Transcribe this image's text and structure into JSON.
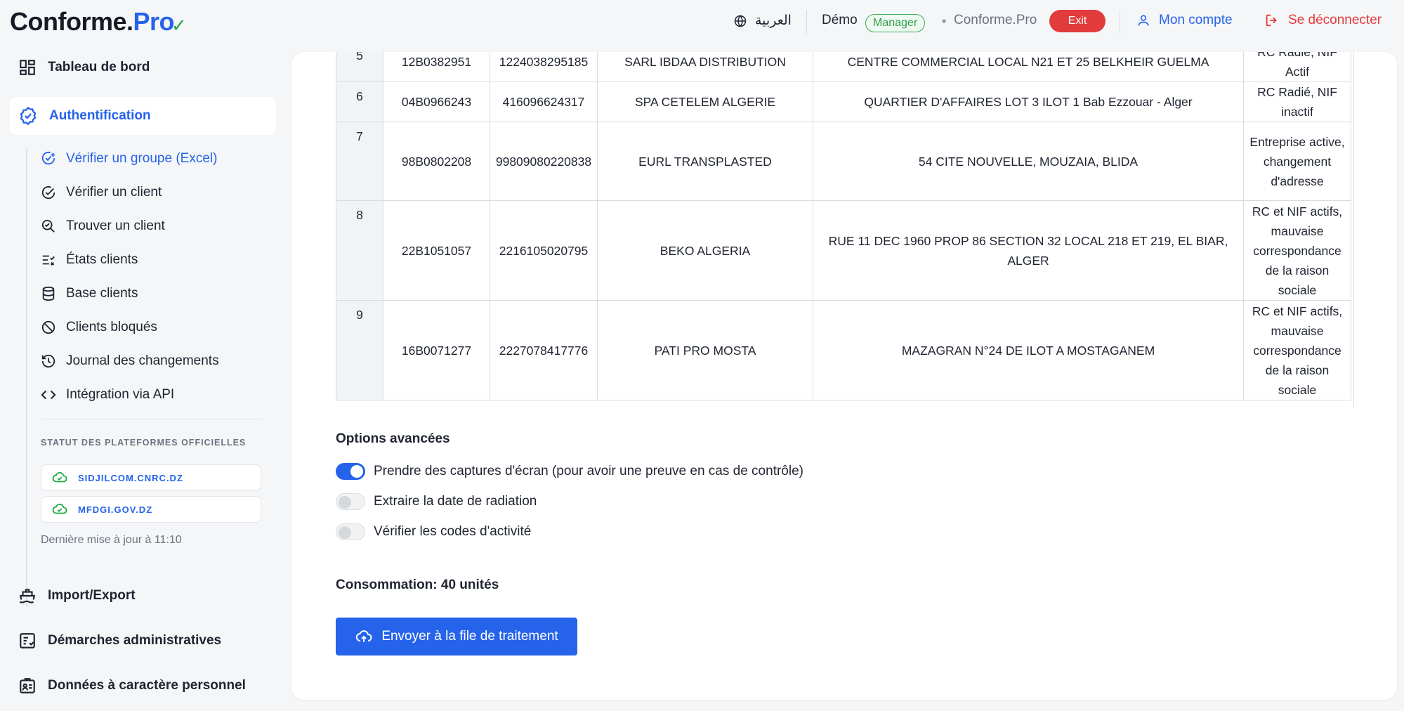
{
  "header": {
    "logo_main": "Conforme.",
    "logo_accent": "Pro",
    "language": "العربية",
    "demo_label": "Démo",
    "role_badge": "Manager",
    "brand_text": "Conforme.Pro",
    "exit_label": "Exit",
    "account_label": "Mon compte",
    "logout_label": "Se déconnecter"
  },
  "sidebar": {
    "dashboard": "Tableau de bord",
    "auth": "Authentification",
    "sub_items": [
      "Vérifier un groupe (Excel)",
      "Vérifier un client",
      "Trouver un client",
      "États clients",
      "Base clients",
      "Clients bloqués",
      "Journal des changements",
      "Intégration via API"
    ],
    "status_title": "STATUT DES PLATEFORMES OFFICIELLES",
    "platforms": [
      "SIDJILCOM.CNRC.DZ",
      "MFDGI.GOV.DZ"
    ],
    "last_update": "Dernière mise à jour à 11:10",
    "import_export": "Import/Export",
    "admin": "Démarches administratives",
    "personal_data": "Données à caractère personnel"
  },
  "table": {
    "rows": [
      {
        "num": "5",
        "rc": "12B0382951",
        "nif": "1224038295185",
        "name": "SARL IBDAA DISTRIBUTION",
        "address": "CENTRE COMMERCIAL LOCAL N21 ET 25 BELKHEIR GUELMA",
        "status": "RC Radié, NIF Actif"
      },
      {
        "num": "6",
        "rc": "04B0966243",
        "nif": "416096624317",
        "name": "SPA CETELEM ALGERIE",
        "address": "QUARTIER D'AFFAIRES LOT 3 ILOT 1 Bab Ezzouar - Alger",
        "status": "RC Radié, NIF inactif"
      },
      {
        "num": "7",
        "rc": "98B0802208",
        "nif": "99809080220838",
        "name": "EURL TRANSPLASTED",
        "address": "54 CITE NOUVELLE, MOUZAIA, BLIDA",
        "status": "Entreprise active, changement d'adresse"
      },
      {
        "num": "8",
        "rc": "22B1051057",
        "nif": "2216105020795",
        "name": "BEKO ALGERIA",
        "address": "RUE 11 DEC 1960 PROP 86 SECTION 32 LOCAL 218 ET 219, EL BIAR, ALGER",
        "status": "RC et NIF actifs, mauvaise correspondance de la raison sociale"
      },
      {
        "num": "9",
        "rc": "16B0071277",
        "nif": "2227078417776",
        "name": "PATI PRO MOSTA",
        "address": "MAZAGRAN N°24 DE ILOT A MOSTAGANEM",
        "status": "RC et NIF actifs, mauvaise correspondance de la raison sociale"
      }
    ]
  },
  "options": {
    "title": "Options avancées",
    "screenshots": {
      "label": "Prendre des captures d'écran (pour avoir une preuve en cas de contrôle)",
      "enabled": true
    },
    "radiation": {
      "label": "Extraire la date de radiation",
      "enabled": false
    },
    "activity_codes": {
      "label": "Vérifier les codes d'activité",
      "enabled": false
    }
  },
  "consumption": {
    "label": "Consommation:",
    "value": "40 unités"
  },
  "submit_label": "Envoyer à la file de traitement",
  "colors": {
    "accent": "#2563eb",
    "danger": "#e23b3b",
    "success": "#22a844"
  }
}
